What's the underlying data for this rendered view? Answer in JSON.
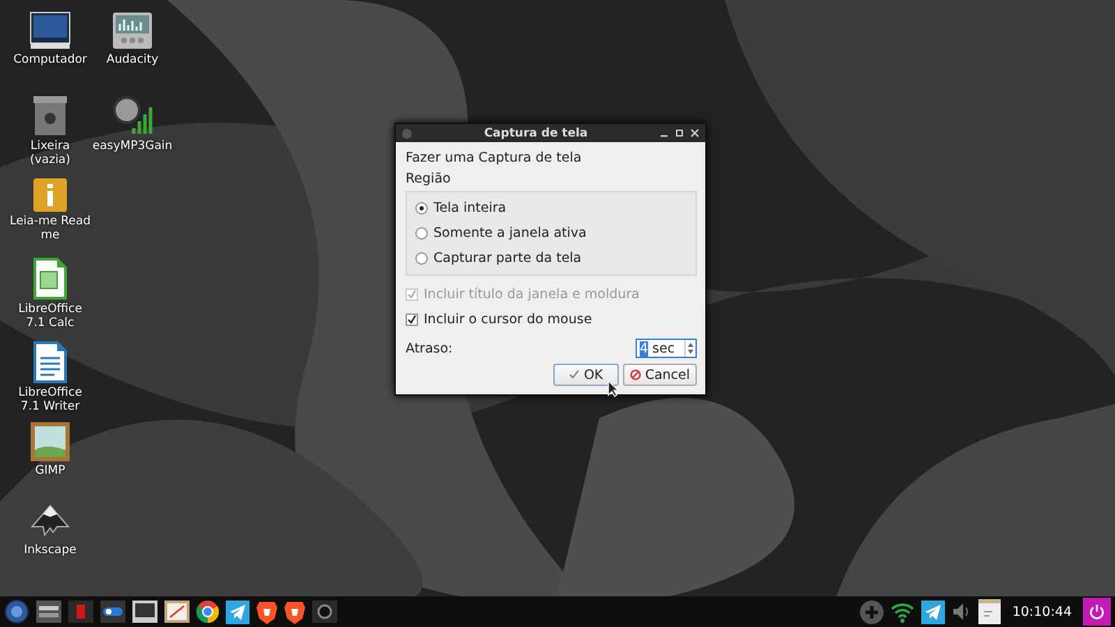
{
  "desktop_icons": [
    {
      "label": "Computador",
      "kind": "monitor"
    },
    {
      "label": "Audacity",
      "kind": "audio"
    },
    {
      "label": "Lixeira\n(vazia)",
      "kind": "trash"
    },
    {
      "label": "easyMP3Gain",
      "kind": "gain"
    },
    {
      "label": "Leia-me Read\nme",
      "kind": "info"
    },
    {
      "label": "LibreOffice\n7.1 Calc",
      "kind": "calc"
    },
    {
      "label": "LibreOffice\n7.1 Writer",
      "kind": "writer"
    },
    {
      "label": "GIMP",
      "kind": "gimp"
    },
    {
      "label": "Inkscape",
      "kind": "inkscape"
    }
  ],
  "dialog": {
    "title": "Captura de tela",
    "heading": "Fazer uma Captura de tela",
    "group_label": "Região",
    "regions": [
      {
        "label": "Tela inteira",
        "selected": true
      },
      {
        "label": "Somente a janela ativa",
        "selected": false
      },
      {
        "label": "Capturar parte da tela",
        "selected": false
      }
    ],
    "options": [
      {
        "label": "Incluir título da janela e moldura",
        "checked": true,
        "disabled": true
      },
      {
        "label": "Incluir o cursor do mouse",
        "checked": true,
        "disabled": false
      }
    ],
    "delay_label": "Atraso:",
    "delay_value": "4",
    "delay_suffix": "sec",
    "buttons": [
      {
        "label": "OK",
        "kind": "ok"
      },
      {
        "label": "Cancel",
        "kind": "cancel"
      }
    ]
  },
  "taskbar": {
    "clock": "10:10:44"
  }
}
